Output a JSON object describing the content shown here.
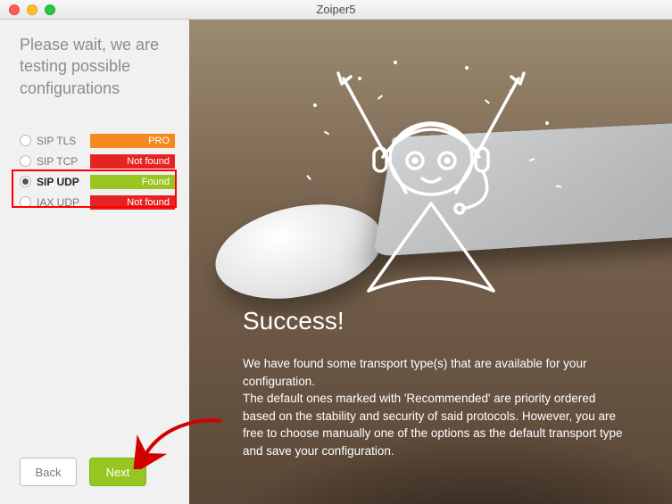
{
  "window": {
    "title": "Zoiper5"
  },
  "sidebar": {
    "heading": "Please wait, we are testing possible configurations",
    "rows": {
      "sip_tls": {
        "label": "SIP TLS",
        "status": "PRO"
      },
      "sip_tcp": {
        "label": "SIP TCP",
        "status": "Not found"
      },
      "sip_udp": {
        "label": "SIP UDP",
        "status": "Found"
      },
      "iax_udp": {
        "label": "IAX UDP",
        "status": "Not found"
      }
    },
    "buttons": {
      "back": "Back",
      "next": "Next"
    }
  },
  "main": {
    "title": "Success!",
    "body1": "We have found some transport type(s) that are available for your configuration.",
    "body2": "The default ones marked with 'Recommended' are priority ordered based on the stability and security of said protocols. However, you are free to choose manually one of the options as the default  transport type and save your configuration."
  },
  "colors": {
    "accent_green": "#98c620",
    "accent_orange": "#f48a1f",
    "error_red": "#e62323",
    "highlight_red": "#ff0000"
  }
}
